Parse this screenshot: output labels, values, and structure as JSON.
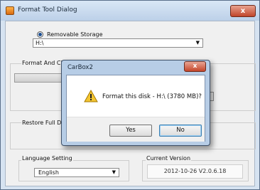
{
  "window": {
    "title": "Format Tool Dialog",
    "close_glyph": "x",
    "radio_label": "Removable Storage",
    "drive_value": "H:\\",
    "group_format_label": "Format And Clea",
    "group_restore_label": "Restore Full Disk",
    "language_label": "Language Setting",
    "language_value": "English",
    "version_label": "Current Version",
    "version_value": "2012-10-26 V2.0.6.18"
  },
  "modal": {
    "title": "CarBox2",
    "close_glyph": "x",
    "message": "Format this disk - H:\\ (3780 MB)?",
    "yes_label": "Yes",
    "no_label": "No",
    "icon": "warning-icon"
  },
  "colors": {
    "title_bar": "#c8daf0",
    "close_red": "#c4452a",
    "warning_yellow": "#f3c530"
  }
}
